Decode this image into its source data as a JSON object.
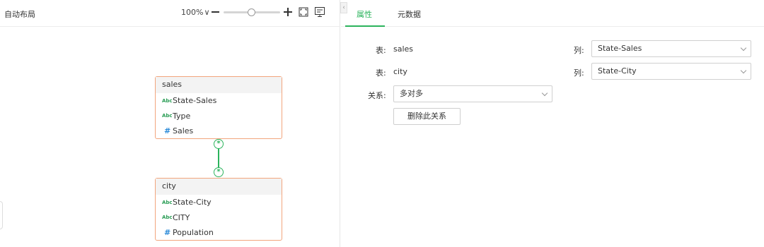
{
  "toolbar": {
    "auto_layout": "自动布局",
    "zoom_level": "100%",
    "zoom_chevron": "∨"
  },
  "canvas": {
    "tables": [
      {
        "name": "sales",
        "fields": [
          {
            "type_label": "Abc",
            "name": "State-Sales"
          },
          {
            "type_label": "Abc",
            "name": "Type"
          },
          {
            "type_label": "#",
            "name": "Sales"
          }
        ]
      },
      {
        "name": "city",
        "fields": [
          {
            "type_label": "Abc",
            "name": "State-City"
          },
          {
            "type_label": "Abc",
            "name": "CITY"
          },
          {
            "type_label": "#",
            "name": "Population"
          }
        ]
      }
    ],
    "link_symbol": "*",
    "accent_color": "#2bb35c",
    "card_border_color": "#f2a57d"
  },
  "tabs": [
    {
      "label": "属性",
      "active": true
    },
    {
      "label": "元数据",
      "active": false
    }
  ],
  "properties": {
    "table_label": "表:",
    "column_label": "列:",
    "relation_label": "关系:",
    "rows": [
      {
        "table": "sales",
        "column": "State-Sales"
      },
      {
        "table": "city",
        "column": "State-City"
      }
    ],
    "relation": "多对多",
    "delete_button": "删除此关系"
  }
}
